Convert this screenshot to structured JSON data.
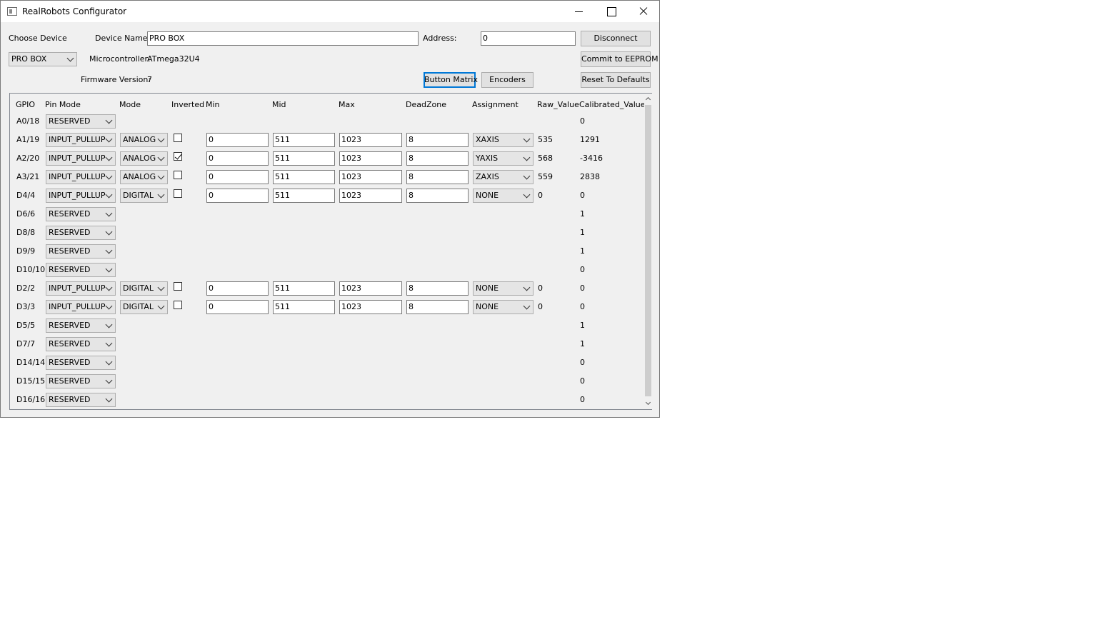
{
  "window": {
    "title": "RealRobots Configurator"
  },
  "top": {
    "choose_device_label": "Choose Device",
    "device_name_label": "Device Name:",
    "device_name_value": "PRO BOX",
    "address_label": "Address:",
    "address_value": "0",
    "disconnect_label": "Disconnect",
    "device_select_value": "PRO BOX",
    "microcontroller_label": "Microcontroller:",
    "microcontroller_value": "ATmega32U4",
    "commit_label": "Commit to EEPROM",
    "firmware_label": "Firmware Version:",
    "firmware_value": "7",
    "button_matrix_label": "Button Matrix",
    "encoders_label": "Encoders",
    "reset_label": "Reset To Defaults"
  },
  "table": {
    "headers": {
      "gpio": "GPIO",
      "pin_mode": "Pin Mode",
      "mode": "Mode",
      "inverted": "Inverted",
      "min": "Min",
      "mid": "Mid",
      "max": "Max",
      "deadzone": "DeadZone",
      "assignment": "Assignment",
      "raw": "Raw_Value",
      "calibrated": "Calibrated_Value"
    },
    "rows": [
      {
        "gpio": "A0/18",
        "pin_mode": "RESERVED",
        "calibrated": "0"
      },
      {
        "gpio": "A1/19",
        "pin_mode": "INPUT_PULLUP",
        "mode": "ANALOG",
        "inverted": false,
        "min": "0",
        "mid": "511",
        "max": "1023",
        "deadzone": "8",
        "assignment": "XAXIS",
        "raw": "535",
        "calibrated": "1291"
      },
      {
        "gpio": "A2/20",
        "pin_mode": "INPUT_PULLUP",
        "mode": "ANALOG",
        "inverted": true,
        "min": "0",
        "mid": "511",
        "max": "1023",
        "deadzone": "8",
        "assignment": "YAXIS",
        "raw": "568",
        "calibrated": "-3416"
      },
      {
        "gpio": "A3/21",
        "pin_mode": "INPUT_PULLUP",
        "mode": "ANALOG",
        "inverted": false,
        "min": "0",
        "mid": "511",
        "max": "1023",
        "deadzone": "8",
        "assignment": "ZAXIS",
        "raw": "559",
        "calibrated": "2838"
      },
      {
        "gpio": "D4/4",
        "pin_mode": "INPUT_PULLUP",
        "mode": "DIGITAL",
        "inverted": false,
        "min": "0",
        "mid": "511",
        "max": "1023",
        "deadzone": "8",
        "assignment": "NONE",
        "raw": "0",
        "calibrated": "0"
      },
      {
        "gpio": "D6/6",
        "pin_mode": "RESERVED",
        "calibrated": "1"
      },
      {
        "gpio": "D8/8",
        "pin_mode": "RESERVED",
        "calibrated": "1"
      },
      {
        "gpio": "D9/9",
        "pin_mode": "RESERVED",
        "calibrated": "1"
      },
      {
        "gpio": "D10/10",
        "pin_mode": "RESERVED",
        "calibrated": "0"
      },
      {
        "gpio": "D2/2",
        "pin_mode": "INPUT_PULLUP",
        "mode": "DIGITAL",
        "inverted": false,
        "min": "0",
        "mid": "511",
        "max": "1023",
        "deadzone": "8",
        "assignment": "NONE",
        "raw": "0",
        "calibrated": "0"
      },
      {
        "gpio": "D3/3",
        "pin_mode": "INPUT_PULLUP",
        "mode": "DIGITAL",
        "inverted": false,
        "min": "0",
        "mid": "511",
        "max": "1023",
        "deadzone": "8",
        "assignment": "NONE",
        "raw": "0",
        "calibrated": "0"
      },
      {
        "gpio": "D5/5",
        "pin_mode": "RESERVED",
        "calibrated": "1"
      },
      {
        "gpio": "D7/7",
        "pin_mode": "RESERVED",
        "calibrated": "1"
      },
      {
        "gpio": "D14/14",
        "pin_mode": "RESERVED",
        "calibrated": "0"
      },
      {
        "gpio": "D15/15",
        "pin_mode": "RESERVED",
        "calibrated": "0"
      },
      {
        "gpio": "D16/16",
        "pin_mode": "RESERVED",
        "calibrated": "0"
      }
    ]
  }
}
